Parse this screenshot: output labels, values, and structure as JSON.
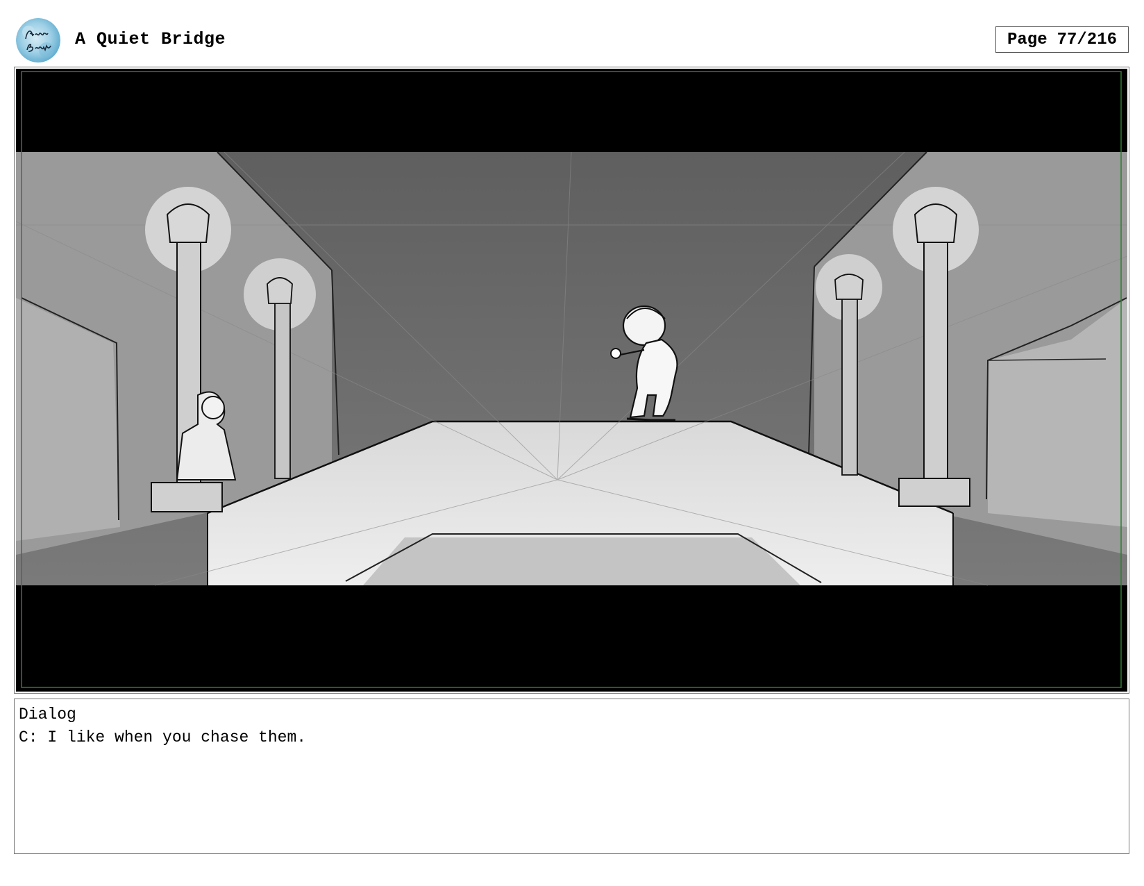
{
  "header": {
    "logo_text": "Anna Brown",
    "title": "A Quiet Bridge",
    "page_label": "Page",
    "page_number": "77/216"
  },
  "dialog": {
    "heading": "Dialog",
    "line": "C: I like when you chase them."
  }
}
